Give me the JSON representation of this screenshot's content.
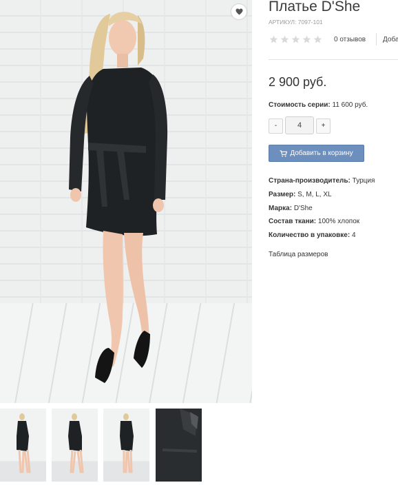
{
  "product": {
    "title": "Платье D'She",
    "sku": "АРТИКУЛ: 7097-101",
    "rating_stars": 0,
    "reviews_label": "0 отзывов",
    "add_review_label": "Доба",
    "price": "2 900 руб."
  },
  "series": {
    "label": "Стоимость серии:",
    "value": "11 600 руб."
  },
  "quantity": {
    "minus_label": "-",
    "value": "4",
    "plus_label": "+"
  },
  "cart": {
    "button_label": "Добавить в корзину",
    "icon": "cart-icon"
  },
  "specs": [
    {
      "label": "Страна-производитель:",
      "value": "Турция"
    },
    {
      "label": "Размер:",
      "value": "S, M, L, XL"
    },
    {
      "label": "Марка:",
      "value": "D'She"
    },
    {
      "label": "Состав ткани:",
      "value": "100% хлопок"
    },
    {
      "label": "Количество в упаковке:",
      "value": "4"
    }
  ],
  "size_table_link": "Таблица размеров",
  "icons": {
    "favorite": "heart-icon",
    "star": "star-icon"
  },
  "colors": {
    "accent_button": "#6d8fbe",
    "star_empty": "#d9d9d9",
    "dress": "#1f2224"
  }
}
